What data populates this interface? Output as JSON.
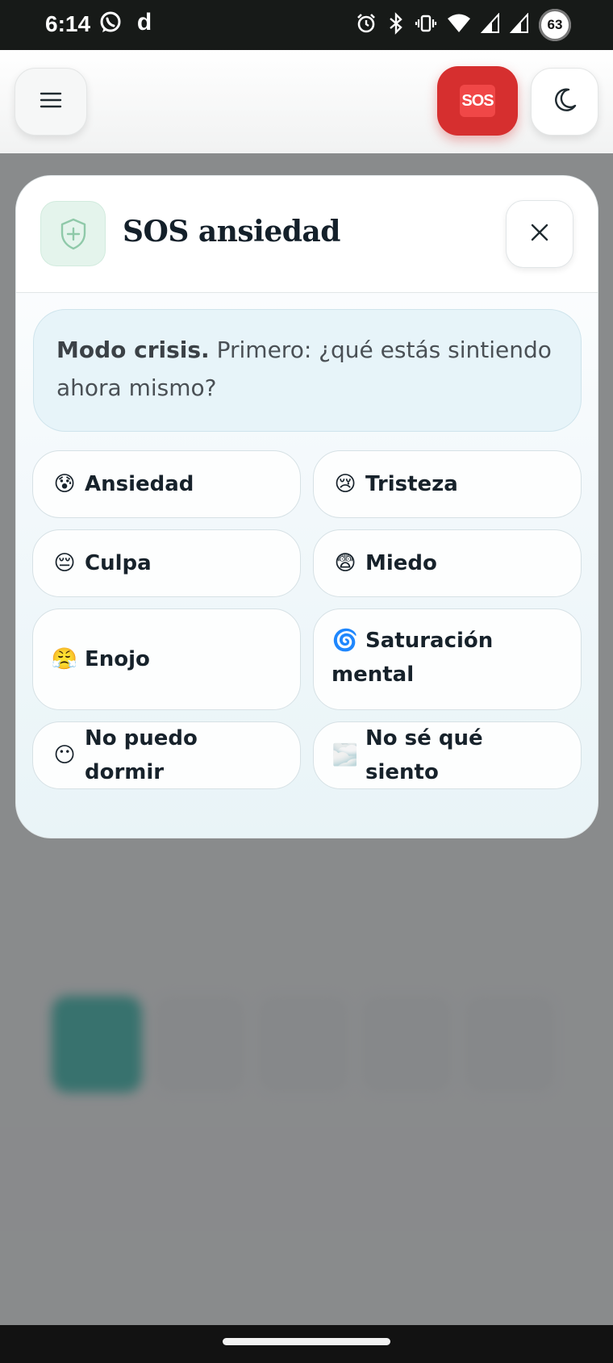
{
  "status_bar": {
    "time": "6:14",
    "left_icons": [
      "whatsapp-icon",
      "d-app-icon"
    ],
    "d_app_letter": "d",
    "right_icons": [
      "alarm-icon",
      "bluetooth-icon",
      "vibrate-icon",
      "wifi-icon",
      "signal-icon",
      "signal-icon"
    ],
    "battery": "63"
  },
  "topbar": {
    "sos_badge": "SOS",
    "menu_icon": "hamburger-menu-icon",
    "theme_icon": "moon-icon"
  },
  "modal": {
    "icon": "shield-plus-icon",
    "title": "SOS ansiedad",
    "close_icon": "close-icon",
    "intro_bold": "Modo crisis.",
    "intro_text": "Primero: ¿qué estás sintiendo ahora mismo?",
    "options": [
      {
        "emoji": "😰",
        "label": "Ansiedad"
      },
      {
        "emoji": "😢",
        "label": "Tristeza"
      },
      {
        "emoji": "😔",
        "label": "Culpa"
      },
      {
        "emoji": "😨",
        "label": "Miedo"
      },
      {
        "emoji": "😤",
        "label": "Enojo"
      },
      {
        "emoji": "🌀",
        "label": "Saturación mental"
      },
      {
        "emoji": "😶",
        "label": "No puedo dormir"
      },
      {
        "emoji": "🌫️",
        "label": "No sé qué siento"
      }
    ]
  },
  "colors": {
    "sos_red": "#d62f2f",
    "title_dark": "#14202a",
    "shield_green": "#e4f4ec",
    "intro_blue": "#e7f4f9"
  }
}
